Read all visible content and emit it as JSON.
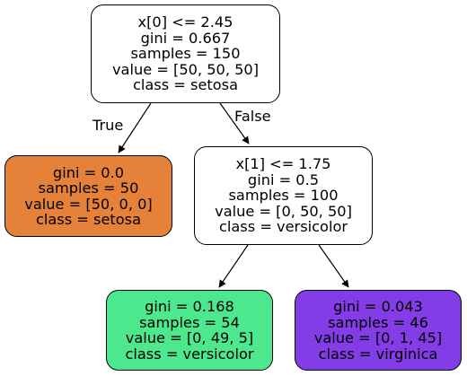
{
  "tree": {
    "root": {
      "lines": [
        "x[0] <= 2.45",
        "gini = 0.667",
        "samples = 150",
        "value = [50, 50, 50]",
        "class = setosa"
      ],
      "fill": "#ffffff"
    },
    "left": {
      "lines": [
        "gini = 0.0",
        "samples = 50",
        "value = [50, 0, 0]",
        "class = setosa"
      ],
      "fill": "#e58139"
    },
    "right": {
      "lines": [
        "x[1] <= 1.75",
        "gini = 0.5",
        "samples = 100",
        "value = [0, 50, 50]",
        "class = versicolor"
      ],
      "fill": "#ffffff"
    },
    "right_left": {
      "lines": [
        "gini = 0.168",
        "samples = 54",
        "value = [0, 49, 5]",
        "class = versicolor"
      ],
      "fill": "#4de88e"
    },
    "right_right": {
      "lines": [
        "gini = 0.043",
        "samples = 46",
        "value = [0, 1, 45]",
        "class = virginica"
      ],
      "fill": "#843de6"
    }
  },
  "edges": {
    "true_label": "True",
    "false_label": "False"
  }
}
